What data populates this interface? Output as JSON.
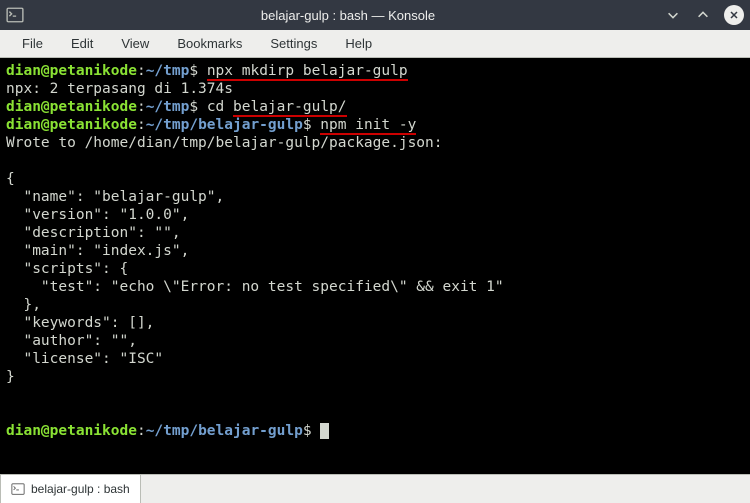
{
  "window": {
    "title": "belajar-gulp : bash — Konsole"
  },
  "menu": {
    "file": "File",
    "edit": "Edit",
    "view": "View",
    "bookmarks": "Bookmarks",
    "settings": "Settings",
    "help": "Help"
  },
  "terminal": {
    "prompt1_user": "dian@petanikode",
    "prompt1_colon": ":",
    "prompt1_path": "~/tmp",
    "prompt1_dollar": "$ ",
    "cmd1": "npx mkdirp belajar-gulp",
    "out1": "npx: 2 terpasang di 1.374s",
    "prompt2_user": "dian@petanikode",
    "prompt2_colon": ":",
    "prompt2_path": "~/tmp",
    "prompt2_dollar": "$ ",
    "cmd2_a": "cd ",
    "cmd2_b": "belajar-gulp/",
    "prompt3_user": "dian@petanikode",
    "prompt3_colon": ":",
    "prompt3_path": "~/tmp/belajar-gulp",
    "prompt3_dollar": "$ ",
    "cmd3": "npm init -y",
    "wrote": "Wrote to /home/dian/tmp/belajar-gulp/package.json:",
    "blank1": "",
    "json1": "{",
    "json2": "  \"name\": \"belajar-gulp\",",
    "json3": "  \"version\": \"1.0.0\",",
    "json4": "  \"description\": \"\",",
    "json5": "  \"main\": \"index.js\",",
    "json6": "  \"scripts\": {",
    "json7": "    \"test\": \"echo \\\"Error: no test specified\\\" && exit 1\"",
    "json8": "  },",
    "json9": "  \"keywords\": [],",
    "json10": "  \"author\": \"\",",
    "json11": "  \"license\": \"ISC\"",
    "json12": "}",
    "blank2": "",
    "blank3": "",
    "prompt4_user": "dian@petanikode",
    "prompt4_colon": ":",
    "prompt4_path": "~/tmp/belajar-gulp",
    "prompt4_dollar": "$ "
  },
  "tab": {
    "label": "belajar-gulp : bash"
  }
}
